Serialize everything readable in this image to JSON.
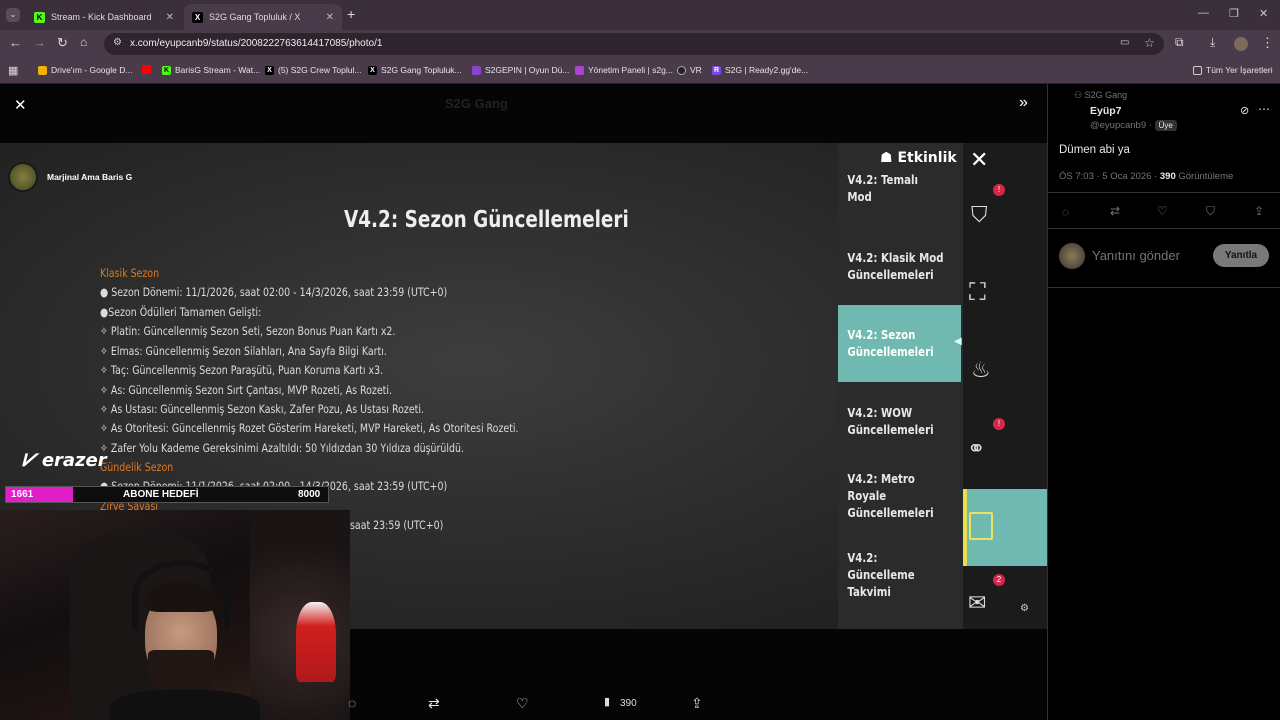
{
  "browser": {
    "tabs": [
      {
        "title": "Stream - Kick Dashboard",
        "icon": "K"
      },
      {
        "title": "S2G Gang Topluluk / X",
        "icon": "X"
      }
    ],
    "new_tab": "+",
    "url": "x.com/eyupcanb9/status/2008222763614417085/photo/1",
    "bookmarks": [
      "Drive'ım - Google D...",
      "BarisG Stream - Wat...",
      "(5) S2G Crew Toplul...",
      "S2G Gang Topluluk...",
      "S2GEPIN | Oyun Dü...",
      "Yönetim Paneli | s2g...",
      "VR",
      "S2G | Ready2.gg'de...",
      "Tüm Yer İşaretleri"
    ]
  },
  "viewer": {
    "bg_header": "S2G Gang",
    "streamer_name": "Marjinal Ama Baris G",
    "game": {
      "title": "V4.2: Sezon Güncellemeleri",
      "lines": [
        "Klasik Sezon",
        "● Sezon Dönemi: 11/1/2026, saat 02:00 - 14/3/2026, saat 23:59 (UTC+0)",
        "●Sezon Ödülleri Tamamen Gelişti:",
        "✧ Platin: Güncellenmiş Sezon Seti, Sezon Bonus Puan Kartı x2.",
        "✧ Elmas: Güncellenmiş Sezon Silahları, Ana Sayfa Bilgi Kartı.",
        "✧ Taç: Güncellenmiş Sezon Paraşütü, Puan Koruma Kartı x3.",
        "✧ As: Güncellenmiş Sezon Sırt Çantası, MVP Rozeti, As Rozeti.",
        "✧ As Ustası: Güncellenmiş Sezon Kaskı, Zafer Pozu, As Ustası Rozeti.",
        "✧ As Otoritesi: Güncellenmiş Rozet Gösterim Hareketi, MVP Hareketi, As Otoritesi Rozeti.",
        "✧ Zafer Yolu Kademe Gereksinimi Azaltıldı: 50 Yıldızdan 30 Yıldıza düşürüldü.",
        "Gündelik Sezon",
        "● Sezon Dönemi: 11/1/2026, saat 02:00 - 14/3/2026, saat 23:59 (UTC+0)",
        "Zirve Savaşı",
        "saat 23:59 (UTC+0)"
      ],
      "panel_title": "Etkinlik",
      "menu": [
        "V4.2: Temalı Mod Güncellemeleri",
        "V4.2: Klasik Mod Güncellemeleri",
        "V4.2: Sezon Güncellemeleri",
        "V4.2: WOW Güncellemeleri",
        "V4.2: Metro Royale Güncellemeleri",
        "V4.2: Güncelleme Takvimi"
      ],
      "badges": [
        "!",
        "!",
        "2"
      ],
      "active_index": 2
    },
    "overlay": {
      "brand": "erazer",
      "goal_current": "1661",
      "goal_label": "ABONE HEDEFİ",
      "goal_target": "8000",
      "goal_progress": 0.2076
    },
    "bottom_bar": {
      "views": "390"
    }
  },
  "post": {
    "community": "S2G Gang",
    "author": "Eyüp7",
    "handle": "@eyupcanb9",
    "role_badge": "Üye",
    "text": "Dümen abi ya",
    "time": "ÖS 7:03 · 5 Oca 2026 ·",
    "views_count": "390",
    "views_label": "Görüntüleme",
    "reply_placeholder": "Yanıtını gönder",
    "reply_button": "Yanıtla"
  },
  "colors": {
    "accent_orange": "#e0781f",
    "menu_active": "#6fb9b0",
    "goal_fill": "#e11ec8",
    "x_bg": "#000000"
  }
}
